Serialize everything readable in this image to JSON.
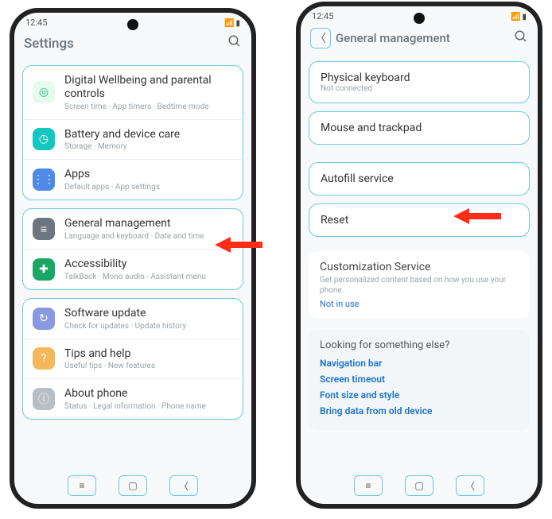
{
  "status": {
    "time": "12:45"
  },
  "left": {
    "title": "Settings",
    "items": [
      {
        "icon": "wellbeing",
        "color": "#e6faef",
        "fg": "#1fb86b",
        "title": "Digital Wellbeing and parental controls",
        "sub": "Screen time · App timers · Bedtime mode"
      },
      {
        "icon": "battery",
        "color": "#13c7c0",
        "fg": "#fff",
        "title": "Battery and device care",
        "sub": "Storage · Memory"
      },
      {
        "icon": "apps",
        "color": "#4f8ae6",
        "fg": "#fff",
        "title": "Apps",
        "sub": "Default apps · App settings"
      }
    ],
    "items2": [
      {
        "icon": "general",
        "color": "#6d7680",
        "fg": "#fff",
        "title": "General management",
        "sub": "Language and keyboard · Date and time"
      },
      {
        "icon": "accessibility",
        "color": "#1aa765",
        "fg": "#fff",
        "title": "Accessibility",
        "sub": "TalkBack · Mono audio · Assistant menu"
      }
    ],
    "items3": [
      {
        "icon": "update",
        "color": "#8a98e0",
        "fg": "#fff",
        "title": "Software update",
        "sub": "Check for updates · Update history"
      },
      {
        "icon": "tips",
        "color": "#f3b85c",
        "fg": "#fff",
        "title": "Tips and help",
        "sub": "Useful tips · New features"
      },
      {
        "icon": "about",
        "color": "#b7bfc5",
        "fg": "#fff",
        "title": "About phone",
        "sub": "Status · Legal information · Phone name"
      }
    ]
  },
  "right": {
    "title": "General management",
    "rows": [
      {
        "title": "Physical keyboard",
        "sub": "Not connected"
      },
      {
        "title": "Mouse and trackpad",
        "sub": ""
      },
      {
        "title": "Autofill service",
        "sub": ""
      },
      {
        "title": "Reset",
        "sub": ""
      }
    ],
    "cust": {
      "title": "Customization Service",
      "sub": "Get personalized content based on how you use your phone.",
      "status": "Not in use"
    },
    "footer": {
      "title": "Looking for something else?",
      "opts": [
        "Navigation bar",
        "Screen timeout",
        "Font size and style",
        "Bring data from old device"
      ]
    }
  }
}
